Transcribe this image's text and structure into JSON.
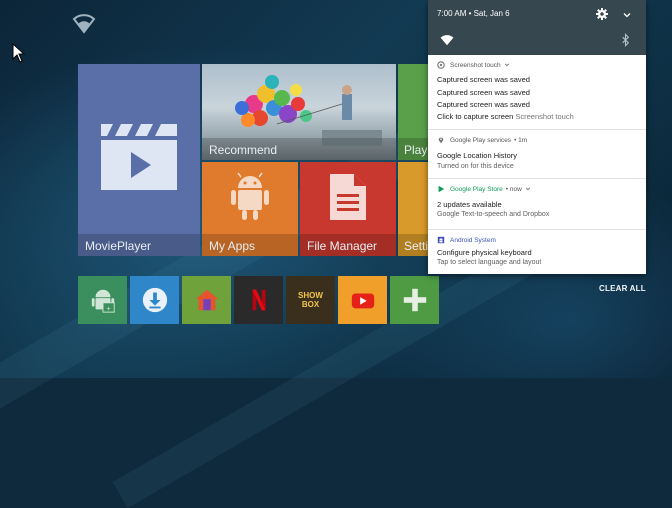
{
  "status": {
    "time_date": "7:00 AM • Sat, Jan 6"
  },
  "tiles": {
    "movieplayer": "MoviePlayer",
    "recommend": "Recommend",
    "play": "Play",
    "my_apps": "My Apps",
    "file_manager": "File Manager",
    "settings": "Setti"
  },
  "app_bar": {
    "showbox_line1": "SHOW",
    "showbox_line2": "BOX",
    "icons": [
      "android-apk-icon",
      "download-icon",
      "home-icon",
      "netflix-icon",
      "showbox-icon",
      "youtube-icon",
      "add-icon"
    ]
  },
  "notifications": [
    {
      "app": "Screenshot touch",
      "lines": [
        "Captured screen was saved",
        "Captured screen was saved",
        "Captured screen was saved"
      ],
      "last_main": "Click to capture screen",
      "last_sub": "Screenshot touch"
    },
    {
      "app": "Google Play services",
      "time": "• 1m",
      "title": "Google Location History",
      "text": "Turned on for this device"
    },
    {
      "app": "Google Play Store",
      "time": "• now",
      "title": "2 updates available",
      "text": "Google Text-to-speech and Dropbox"
    },
    {
      "app": "Android System",
      "title": "Configure physical keyboard",
      "text": "Tap to select language and layout"
    }
  ],
  "clear_all": "CLEAR ALL",
  "colors": {
    "qs_bg": "#37474f",
    "play_store_green": "#0f9d58",
    "android_system_blue": "#3f51b5"
  }
}
